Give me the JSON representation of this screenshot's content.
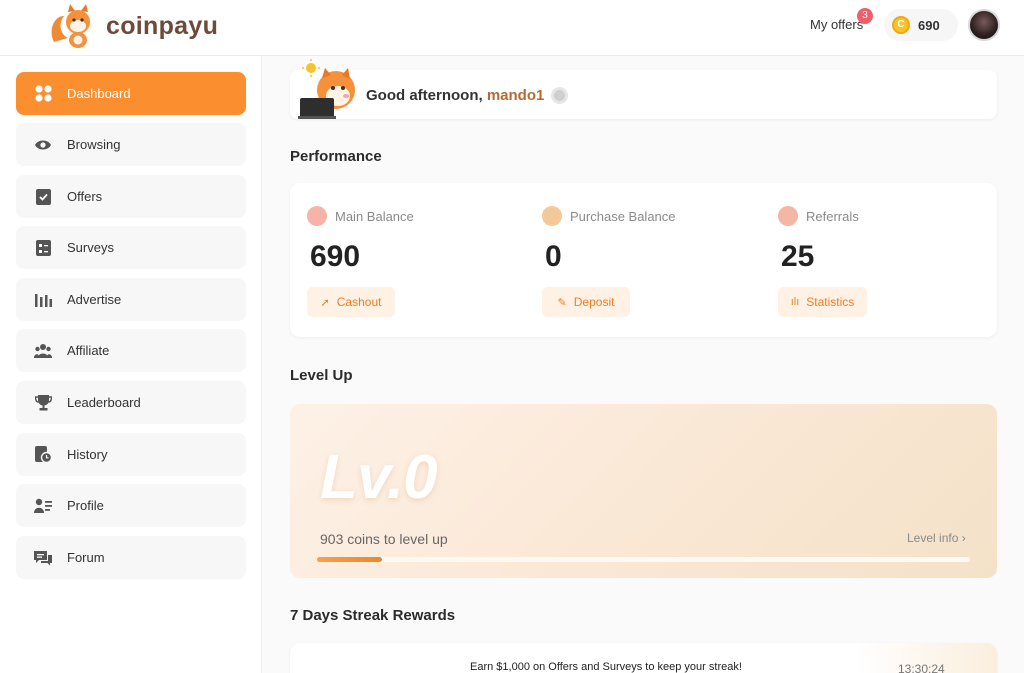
{
  "brand": {
    "name": "coinpayu"
  },
  "header": {
    "my_offers_label": "My offers",
    "my_offers_count": "3",
    "coin_icon_text": "C",
    "balance": "690"
  },
  "sidebar": {
    "items": [
      {
        "label": "Dashboard",
        "icon": "dashboard-icon",
        "active": true
      },
      {
        "label": "Browsing",
        "icon": "eye-icon"
      },
      {
        "label": "Offers",
        "icon": "clipboard-check-icon"
      },
      {
        "label": "Surveys",
        "icon": "survey-icon"
      },
      {
        "label": "Advertise",
        "icon": "bar-chart-icon"
      },
      {
        "label": "Affiliate",
        "icon": "users-icon"
      },
      {
        "label": "Leaderboard",
        "icon": "trophy-icon"
      },
      {
        "label": "History",
        "icon": "history-icon"
      },
      {
        "label": "Profile",
        "icon": "profile-card-icon"
      },
      {
        "label": "Forum",
        "icon": "chat-icon"
      }
    ]
  },
  "greeting": {
    "prefix": "Good afternoon, ",
    "username": "mando1"
  },
  "performance": {
    "title": "Performance",
    "stats": [
      {
        "label": "Main Balance",
        "value": "690",
        "button": "Cashout",
        "icon_color": "#f7b3a8"
      },
      {
        "label": "Purchase Balance",
        "value": "0",
        "button": "Deposit",
        "icon_color": "#f5c89a"
      },
      {
        "label": "Referrals",
        "value": "25",
        "button": "Statistics",
        "icon_color": "#f3b7a3"
      }
    ]
  },
  "level_up": {
    "title": "Level Up",
    "level_label": "Lv.0",
    "coins_to_level": "903 coins to level up",
    "info_link": "Level info ›",
    "progress_fraction": 0.1
  },
  "streak": {
    "title": "7 Days Streak Rewards",
    "message": "Earn $1,000 on Offers and Surveys to keep your streak!",
    "timer": "13:30:24"
  },
  "colors": {
    "accent": "#fb8e2f",
    "brand_text": "#6e4a3a",
    "badge": "#ef5f6b"
  }
}
